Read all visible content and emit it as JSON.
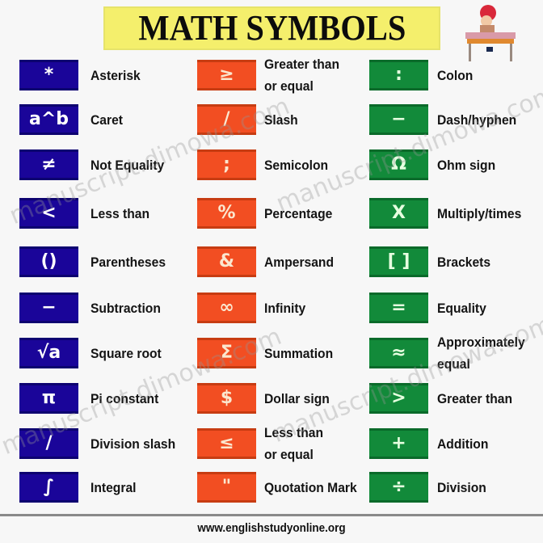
{
  "title": "MATH SYMBOLS",
  "footer": "www.englishstudyonline.org",
  "watermark": "manuscript.dimowa.com",
  "colors": {
    "blue": "#1a0599",
    "orange": "#f24e22",
    "green": "#128a3a",
    "title_bg": "#f4ef6c"
  },
  "columns": [
    {
      "color": "blue",
      "items": [
        {
          "symbol": "*",
          "label_lines": [
            "Asterisk"
          ]
        },
        {
          "symbol": "a^b",
          "label_lines": [
            "Caret"
          ]
        },
        {
          "symbol": "≠",
          "label_lines": [
            "Not Equality"
          ]
        },
        {
          "symbol": "<",
          "label_lines": [
            "Less than"
          ]
        },
        {
          "symbol": "()",
          "label_lines": [
            "Parentheses"
          ]
        },
        {
          "symbol": "−",
          "label_lines": [
            "Subtraction"
          ]
        },
        {
          "symbol": "√a",
          "label_lines": [
            "Square root"
          ]
        },
        {
          "symbol": "π",
          "label_lines": [
            "Pi constant"
          ]
        },
        {
          "symbol": "/",
          "label_lines": [
            "Division slash"
          ]
        },
        {
          "symbol": "∫",
          "label_lines": [
            "Integral"
          ]
        }
      ]
    },
    {
      "color": "orange",
      "items": [
        {
          "symbol": "≥",
          "label_lines": [
            "Greater than",
            "or equal"
          ]
        },
        {
          "symbol": "/",
          "label_lines": [
            "Slash"
          ]
        },
        {
          "symbol": ";",
          "label_lines": [
            "Semicolon"
          ]
        },
        {
          "symbol": "%",
          "label_lines": [
            "Percentage"
          ]
        },
        {
          "symbol": "&",
          "label_lines": [
            "Ampersand"
          ]
        },
        {
          "symbol": "∞",
          "label_lines": [
            "Infinity"
          ]
        },
        {
          "symbol": "Σ",
          "label_lines": [
            "Summation"
          ]
        },
        {
          "symbol": "$",
          "label_lines": [
            "Dollar sign"
          ]
        },
        {
          "symbol": "≤",
          "label_lines": [
            "Less than",
            "or equal"
          ]
        },
        {
          "symbol": "\"",
          "label_lines": [
            "Quotation Mark"
          ]
        }
      ]
    },
    {
      "color": "green",
      "items": [
        {
          "symbol": ":",
          "label_lines": [
            "Colon"
          ]
        },
        {
          "symbol": "−",
          "label_lines": [
            "Dash/hyphen"
          ]
        },
        {
          "symbol": "Ω",
          "label_lines": [
            "Ohm sign"
          ]
        },
        {
          "symbol": "X",
          "label_lines": [
            "Multiply/times"
          ]
        },
        {
          "symbol": "[ ]",
          "label_lines": [
            "Brackets"
          ]
        },
        {
          "symbol": "=",
          "label_lines": [
            "Equality"
          ]
        },
        {
          "symbol": "≈",
          "label_lines": [
            "Approximately",
            "equal"
          ]
        },
        {
          "symbol": ">",
          "label_lines": [
            "Greater than"
          ]
        },
        {
          "symbol": "+",
          "label_lines": [
            "Addition"
          ]
        },
        {
          "symbol": "÷",
          "label_lines": [
            "Division"
          ]
        }
      ]
    }
  ]
}
